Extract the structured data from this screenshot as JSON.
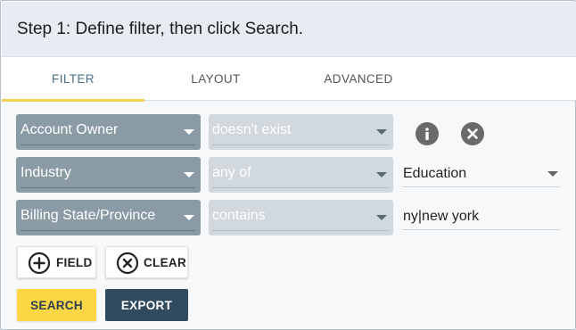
{
  "header": {
    "title": "Step 1: Define filter, then click Search."
  },
  "tabs": [
    {
      "label": "FILTER",
      "active": true
    },
    {
      "label": "LAYOUT",
      "active": false
    },
    {
      "label": "ADVANCED",
      "active": false
    }
  ],
  "filters": [
    {
      "field": "Account Owner",
      "operator": "doesn't exist",
      "value": ""
    },
    {
      "field": "Industry",
      "operator": "any of",
      "value": "Education"
    },
    {
      "field": "Billing State/Province",
      "operator": "contains",
      "value": "ny|new york"
    }
  ],
  "row_actions": {
    "info_icon": "info-icon",
    "remove_icon": "close-icon"
  },
  "buttons": {
    "add_field": "FIELD",
    "clear": "CLEAR",
    "search": "SEARCH",
    "export": "EXPORT"
  },
  "colors": {
    "accent_yellow": "#fdd646",
    "export_navy": "#304b5f",
    "field_select_bg": "#8b9ba6",
    "operator_select_bg": "#d1d9df",
    "active_tab_text": "#4a6f86"
  }
}
